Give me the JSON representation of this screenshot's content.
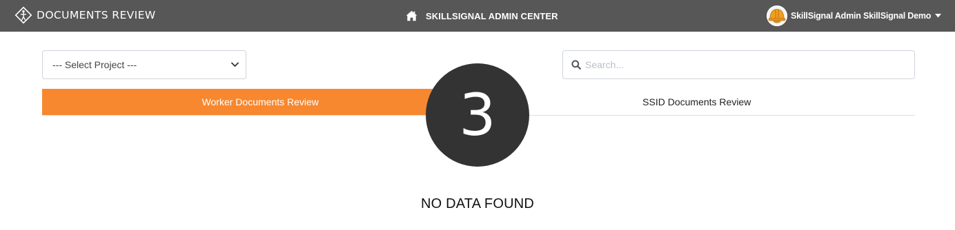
{
  "header": {
    "app_title": "DOCUMENTS REVIEW",
    "center_label": "SKILLSIGNAL ADMIN CENTER",
    "user_name": "SkillSignal Admin SkillSignal Demo",
    "icons": {
      "logo": "compass-person-logo-icon",
      "center": "home-icon",
      "avatar": "hard-hat-avatar",
      "menu": "caret-down-icon"
    }
  },
  "filters": {
    "project_select": {
      "selected": "--- Select Project ---"
    },
    "search": {
      "placeholder": "Search..."
    }
  },
  "tabs": [
    {
      "label": "Worker Documents Review",
      "active": true
    },
    {
      "label": "SSID Documents Review",
      "active": false
    }
  ],
  "step_badge": "3",
  "empty_state": "NO DATA FOUND",
  "colors": {
    "header_bg": "#575757",
    "accent": "#f7882f",
    "badge_bg": "#333333"
  }
}
